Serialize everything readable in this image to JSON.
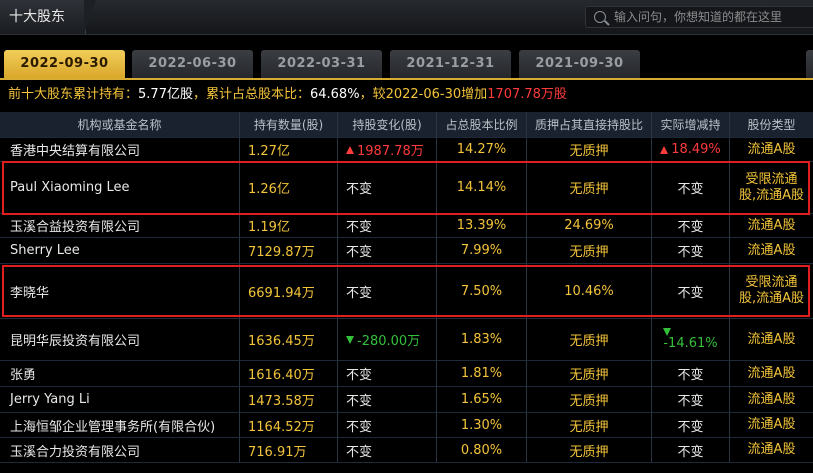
{
  "window": {
    "title": "十大股东"
  },
  "search": {
    "placeholder": "输入问句，你想知道的都在这里"
  },
  "tabs": [
    "2022-09-30",
    "2022-06-30",
    "2022-03-31",
    "2021-12-31",
    "2021-09-30"
  ],
  "summary": {
    "prefix": "前十大股东累计持有：",
    "shares": "5.77亿股",
    "sep1": "，累计占总股本比：",
    "ratio": "64.68%",
    "sep2": "，较",
    "compare_date": "2022-06-30",
    "change_word": "增加",
    "change_value": "1707.78万股"
  },
  "headers": [
    "机构或基金名称",
    "持有数量(股)",
    "持股变化(股)",
    "占总股本比例",
    "质押占其直接持股比",
    "实际增减持",
    "股份类型"
  ],
  "rows": [
    {
      "name": "香港中央结算有限公司",
      "qty": "1.27亿",
      "change": "1987.78万",
      "ratio": "14.27%",
      "pledge": "无质押",
      "actual": "18.49%",
      "type": "流通A股"
    },
    {
      "name": "Paul Xiaoming Lee",
      "qty": "1.26亿",
      "change": "不变",
      "ratio": "14.14%",
      "pledge": "无质押",
      "actual": "不变",
      "type": "受限流通股,流通A股"
    },
    {
      "name": "玉溪合益投资有限公司",
      "qty": "1.19亿",
      "change": "不变",
      "ratio": "13.39%",
      "pledge": "24.69%",
      "actual": "不变",
      "type": "流通A股"
    },
    {
      "name": "Sherry Lee",
      "qty": "7129.87万",
      "change": "不变",
      "ratio": "7.99%",
      "pledge": "无质押",
      "actual": "不变",
      "type": "流通A股"
    },
    {
      "name": "李晓华",
      "qty": "6691.94万",
      "change": "不变",
      "ratio": "7.50%",
      "pledge": "10.46%",
      "actual": "不变",
      "type": "受限流通股,流通A股"
    },
    {
      "name": "昆明华辰投资有限公司",
      "qty": "1636.45万",
      "change": "-280.00万",
      "ratio": "1.83%",
      "pledge": "无质押",
      "actual": "-14.61%",
      "type": "流通A股"
    },
    {
      "name": "张勇",
      "qty": "1616.40万",
      "change": "不变",
      "ratio": "1.81%",
      "pledge": "无质押",
      "actual": "不变",
      "type": "流通A股"
    },
    {
      "name": "Jerry Yang Li",
      "qty": "1473.58万",
      "change": "不变",
      "ratio": "1.65%",
      "pledge": "无质押",
      "actual": "不变",
      "type": "流通A股"
    },
    {
      "name": "上海恒邹企业管理事务所(有限合伙)",
      "qty": "1164.52万",
      "change": "不变",
      "ratio": "1.30%",
      "pledge": "无质押",
      "actual": "不变",
      "type": "流通A股"
    },
    {
      "name": "玉溪合力投资有限公司",
      "qty": "716.91万",
      "change": "不变",
      "ratio": "0.80%",
      "pledge": "无质押",
      "actual": "不变",
      "type": "流通A股"
    }
  ],
  "type_lines": {
    "restricted_line1": "受限流通",
    "restricted_line2": "股,流通A股"
  },
  "colors": {
    "accent": "#f3c43a",
    "up": "#ff3b3b",
    "down": "#33c03a",
    "highlight": "#e01e1e"
  }
}
